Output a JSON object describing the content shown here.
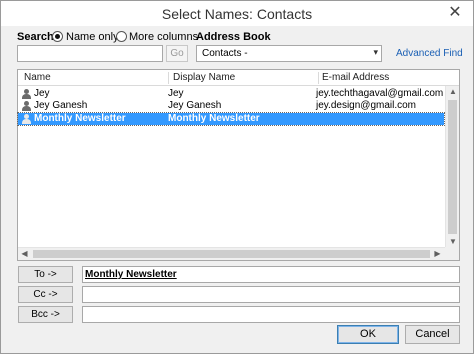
{
  "window": {
    "title": "Select Names: Contacts"
  },
  "search": {
    "label": "Search:",
    "option_name_only": "Name only",
    "option_more_columns": "More columns",
    "selected_option": "Name only",
    "input_value": "",
    "go_label": "Go"
  },
  "address_book": {
    "label": "Address Book",
    "selected": "Contacts -",
    "advanced_find": "Advanced Find"
  },
  "contacts": {
    "columns": [
      "Name",
      "Display Name",
      "E-mail Address"
    ],
    "rows": [
      {
        "name": "Jey",
        "display_name": "Jey",
        "email": "jey.techthagaval@gmail.com"
      },
      {
        "name": "Jey Ganesh",
        "display_name": "Jey Ganesh",
        "email": "jey.design@gmail.com"
      },
      {
        "name": "Monthly Newsletter",
        "display_name": "Monthly Newsletter",
        "email": ""
      }
    ],
    "selected_row": 2
  },
  "recipients": {
    "to_label": "To ->",
    "to_value": "Monthly Newsletter",
    "cc_label": "Cc ->",
    "cc_value": "",
    "bcc_label": "Bcc ->",
    "bcc_value": ""
  },
  "buttons": {
    "ok": "OK",
    "cancel": "Cancel"
  },
  "icons": {
    "close": "close-icon",
    "contact": "person-icon",
    "dropdown": "chevron-down-icon"
  },
  "colors": {
    "selection": "#3399ff",
    "link": "#1a5fb4",
    "dialog_bg": "#f0f0f0"
  }
}
